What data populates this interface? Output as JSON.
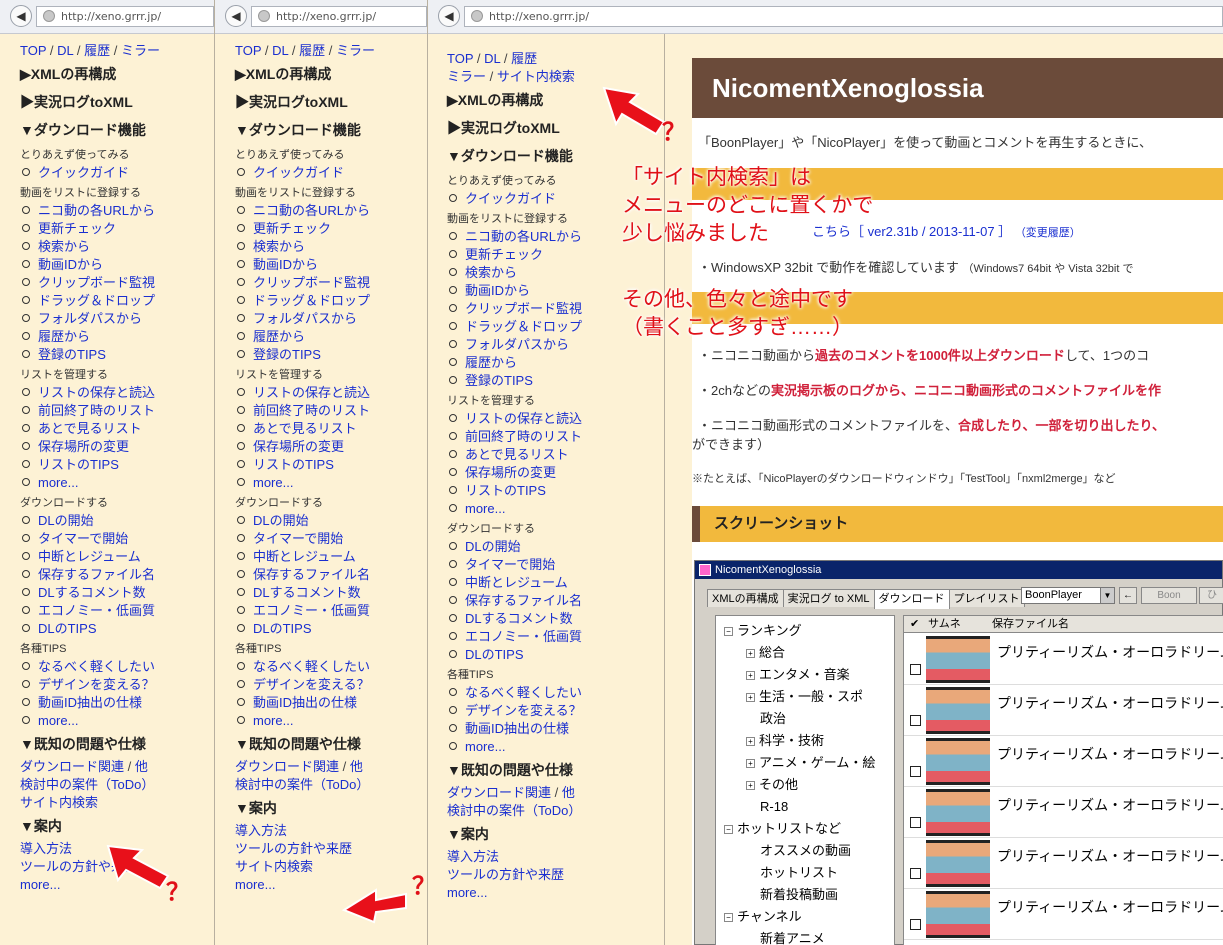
{
  "url": "http://xeno.grrr.jp/",
  "nav": {
    "top": "TOP",
    "dl": "DL",
    "history": "履歴",
    "mirror": "ミラー",
    "sep": "/",
    "site_search": "サイト内検索"
  },
  "menu": {
    "xml": "▶XMLの再構成",
    "jikkyo": "▶実況ログtoXML",
    "download": "▼ダウンロード機能",
    "g1": "とりあえず使ってみる",
    "quick": "クイックガイド",
    "g2": "動画をリストに登録する",
    "reg": [
      "ニコ動の各URLから",
      "更新チェック",
      "検索から",
      "動画IDから",
      "クリップボード監視",
      "ドラッグ＆ドロップ",
      "フォルダパスから",
      "履歴から",
      "登録のTIPS"
    ],
    "g3": "リストを管理する",
    "list": [
      "リストの保存と読込",
      "前回終了時のリスト",
      "あとで見るリスト",
      "保存場所の変更",
      "リストのTIPS",
      "more..."
    ],
    "g4": "ダウンロードする",
    "dl": [
      "DLの開始",
      "タイマーで開始",
      "中断とレジューム",
      "保存するファイル名",
      "DLするコメント数",
      "エコノミー・低画質",
      "DLのTIPS"
    ],
    "g5": "各種TIPS",
    "tips": [
      "なるべく軽くしたい",
      "デザインを変える？",
      "動画ID抽出の仕様",
      "more..."
    ],
    "known": "▼既知の問題や仕様",
    "dl_related": "ダウンロード関連",
    "other": "他",
    "todo": "検討中の案件（ToDo）",
    "guide": "▼案内",
    "intro": "導入方法",
    "policy": "ツールの方針や来歴",
    "more": "more..."
  },
  "content": {
    "title": "NicomentXenoglossia",
    "p1": "「BoonPlayer」や「NicoPlayer」を使って動画とコメントを再生するときに、",
    "dl_line": "こちら［ ver2.31b / 2013-11-07 ］",
    "changelog": "（変更履歴）",
    "os_line": "・WindowsXP 32bit で動作を確認しています",
    "os_small": "（Windows7 64bit や Vista 32bit で",
    "f1a": "・ニコニコ動画から",
    "f1b": "過去のコメントを1000件以上ダウンロード",
    "f1c": "して、1つのコ",
    "f2a": "・2chなどの",
    "f2b": "実況掲示板のログから、ニコニコ動画形式のコメントファイルを作",
    "f3a": "・ニコニコ動画形式のコメントファイルを、",
    "f3b": "合成したり、一部を切り出したり、",
    "f3c": "ができます）",
    "ex": "※たとえば、「NicoPlayerのダウンロードウィンドウ」「TestTool」「nxml2merge」など",
    "screenshot": "スクリーンショット"
  },
  "app": {
    "title": "NicomentXenoglossia",
    "tabs": [
      "XMLの再構成",
      "実況ログ to XML",
      "ダウンロード",
      "プレイリスト"
    ],
    "player": "BoonPlayer",
    "btn_back": "←",
    "btn_boon": "Boon",
    "btn_more": "ひ",
    "tree": [
      {
        "label": "ランキング",
        "mark": "−",
        "indent": 0
      },
      {
        "label": "総合",
        "mark": "+",
        "indent": 1
      },
      {
        "label": "エンタメ・音楽",
        "mark": "+",
        "indent": 1
      },
      {
        "label": "生活・一般・スポ",
        "mark": "+",
        "indent": 1
      },
      {
        "label": "政治",
        "mark": "",
        "indent": 1
      },
      {
        "label": "科学・技術",
        "mark": "+",
        "indent": 1
      },
      {
        "label": "アニメ・ゲーム・絵",
        "mark": "+",
        "indent": 1
      },
      {
        "label": "その他",
        "mark": "+",
        "indent": 1
      },
      {
        "label": "R-18",
        "mark": "",
        "indent": 1
      },
      {
        "label": "ホットリストなど",
        "mark": "−",
        "indent": 0
      },
      {
        "label": "オススメの動画",
        "mark": "",
        "indent": 1
      },
      {
        "label": "ホットリスト",
        "mark": "",
        "indent": 1
      },
      {
        "label": "新着投稿動画",
        "mark": "",
        "indent": 1
      },
      {
        "label": "チャンネル",
        "mark": "−",
        "indent": 0
      },
      {
        "label": "新着アニメ",
        "mark": "",
        "indent": 1
      }
    ],
    "col_check": "✔",
    "col_thumb": "サムネ",
    "col_file": "保存ファイル名",
    "rows": [
      "プリティーリズム・オーロラドリーム",
      "プリティーリズム・オーロラドリーム",
      "プリティーリズム・オーロラドリーム",
      "プリティーリズム・オーロラドリーム",
      "プリティーリズム・オーロラドリーム",
      "プリティーリズム・オーロラドリーム"
    ]
  },
  "annotations": {
    "q": "？",
    "note1": [
      "「サイト内検索」は",
      "メニューのどこに置くかで",
      "少し悩みました"
    ],
    "note2": [
      "その他、色々と途中です",
      "（書くこと多すぎ……）"
    ]
  }
}
